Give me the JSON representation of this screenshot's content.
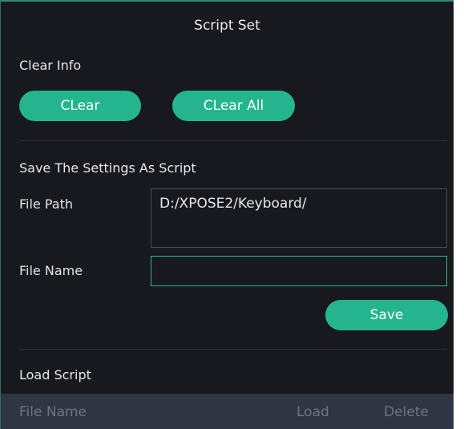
{
  "dialog": {
    "title": "Script Set"
  },
  "clear_info": {
    "label": "Clear Info",
    "clear_button": "CLear",
    "clear_all_button": "CLear All"
  },
  "save_section": {
    "label": "Save The Settings As Script",
    "file_path_label": "File Path",
    "file_path_value": "D:/XPOSE2/Keyboard/",
    "file_name_label": "File Name",
    "file_name_value": "",
    "save_button": "Save"
  },
  "load_section": {
    "label": "Load Script",
    "columns": [
      "File Name",
      "Load",
      "Delete"
    ],
    "rows": []
  },
  "colors": {
    "accent": "#24b58f",
    "panel_bg": "#17191e",
    "header_bg": "#2f3542"
  }
}
